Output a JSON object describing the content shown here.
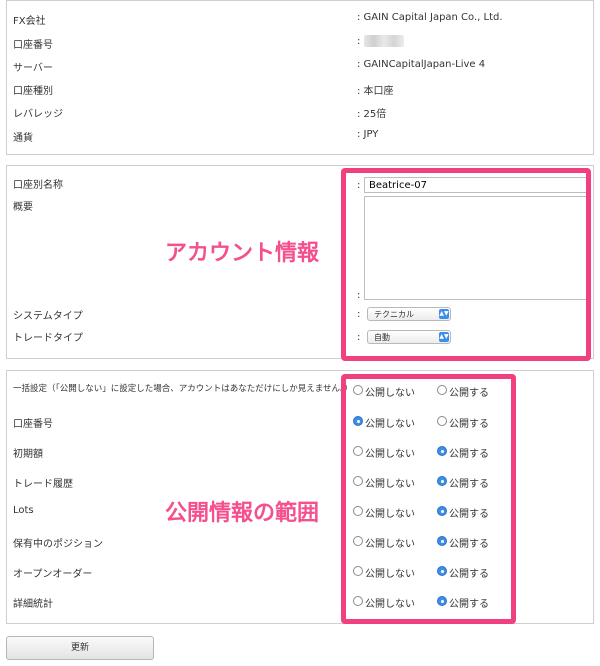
{
  "account_summary": {
    "rows": [
      {
        "label": "FX会社",
        "value": ": GAIN Capital Japan Co., Ltd."
      },
      {
        "label": "口座番号",
        "value": ":"
      },
      {
        "label": "サーバー",
        "value": ": GAINCapitalJapan-Live 4"
      },
      {
        "label": "口座種別",
        "value": ": 本口座"
      },
      {
        "label": "レバレッジ",
        "value": ": 25倍"
      },
      {
        "label": "通貨",
        "value": ": JPY"
      }
    ]
  },
  "account_info": {
    "name_label": "口座別名称",
    "name_value": "Beatrice-07",
    "overview_label": "概要",
    "system_type_label": "システムタイプ",
    "system_type_value": "テクニカル",
    "trade_type_label": "トレードタイプ",
    "trade_type_value": "自動",
    "colon": ":"
  },
  "visibility": {
    "private_label": "公開しない",
    "public_label": "公開する",
    "rows": [
      {
        "label": "一括設定（「公開しない」に設定した場合、アカウントはあなただけにしか見えません。）",
        "selected": "none"
      },
      {
        "label": "口座番号",
        "selected": "private"
      },
      {
        "label": "初期額",
        "selected": "public"
      },
      {
        "label": "トレード履歴",
        "selected": "public"
      },
      {
        "label": "Lots",
        "selected": "public"
      },
      {
        "label": "保有中のポジション",
        "selected": "public"
      },
      {
        "label": "オープンオーダー",
        "selected": "public"
      },
      {
        "label": "詳細統計",
        "selected": "public"
      }
    ]
  },
  "annotations": {
    "account_info_title": "アカウント情報",
    "visibility_title": "公開情報の範囲",
    "highlight_color": "#f04080"
  },
  "update_button_label": "更新"
}
